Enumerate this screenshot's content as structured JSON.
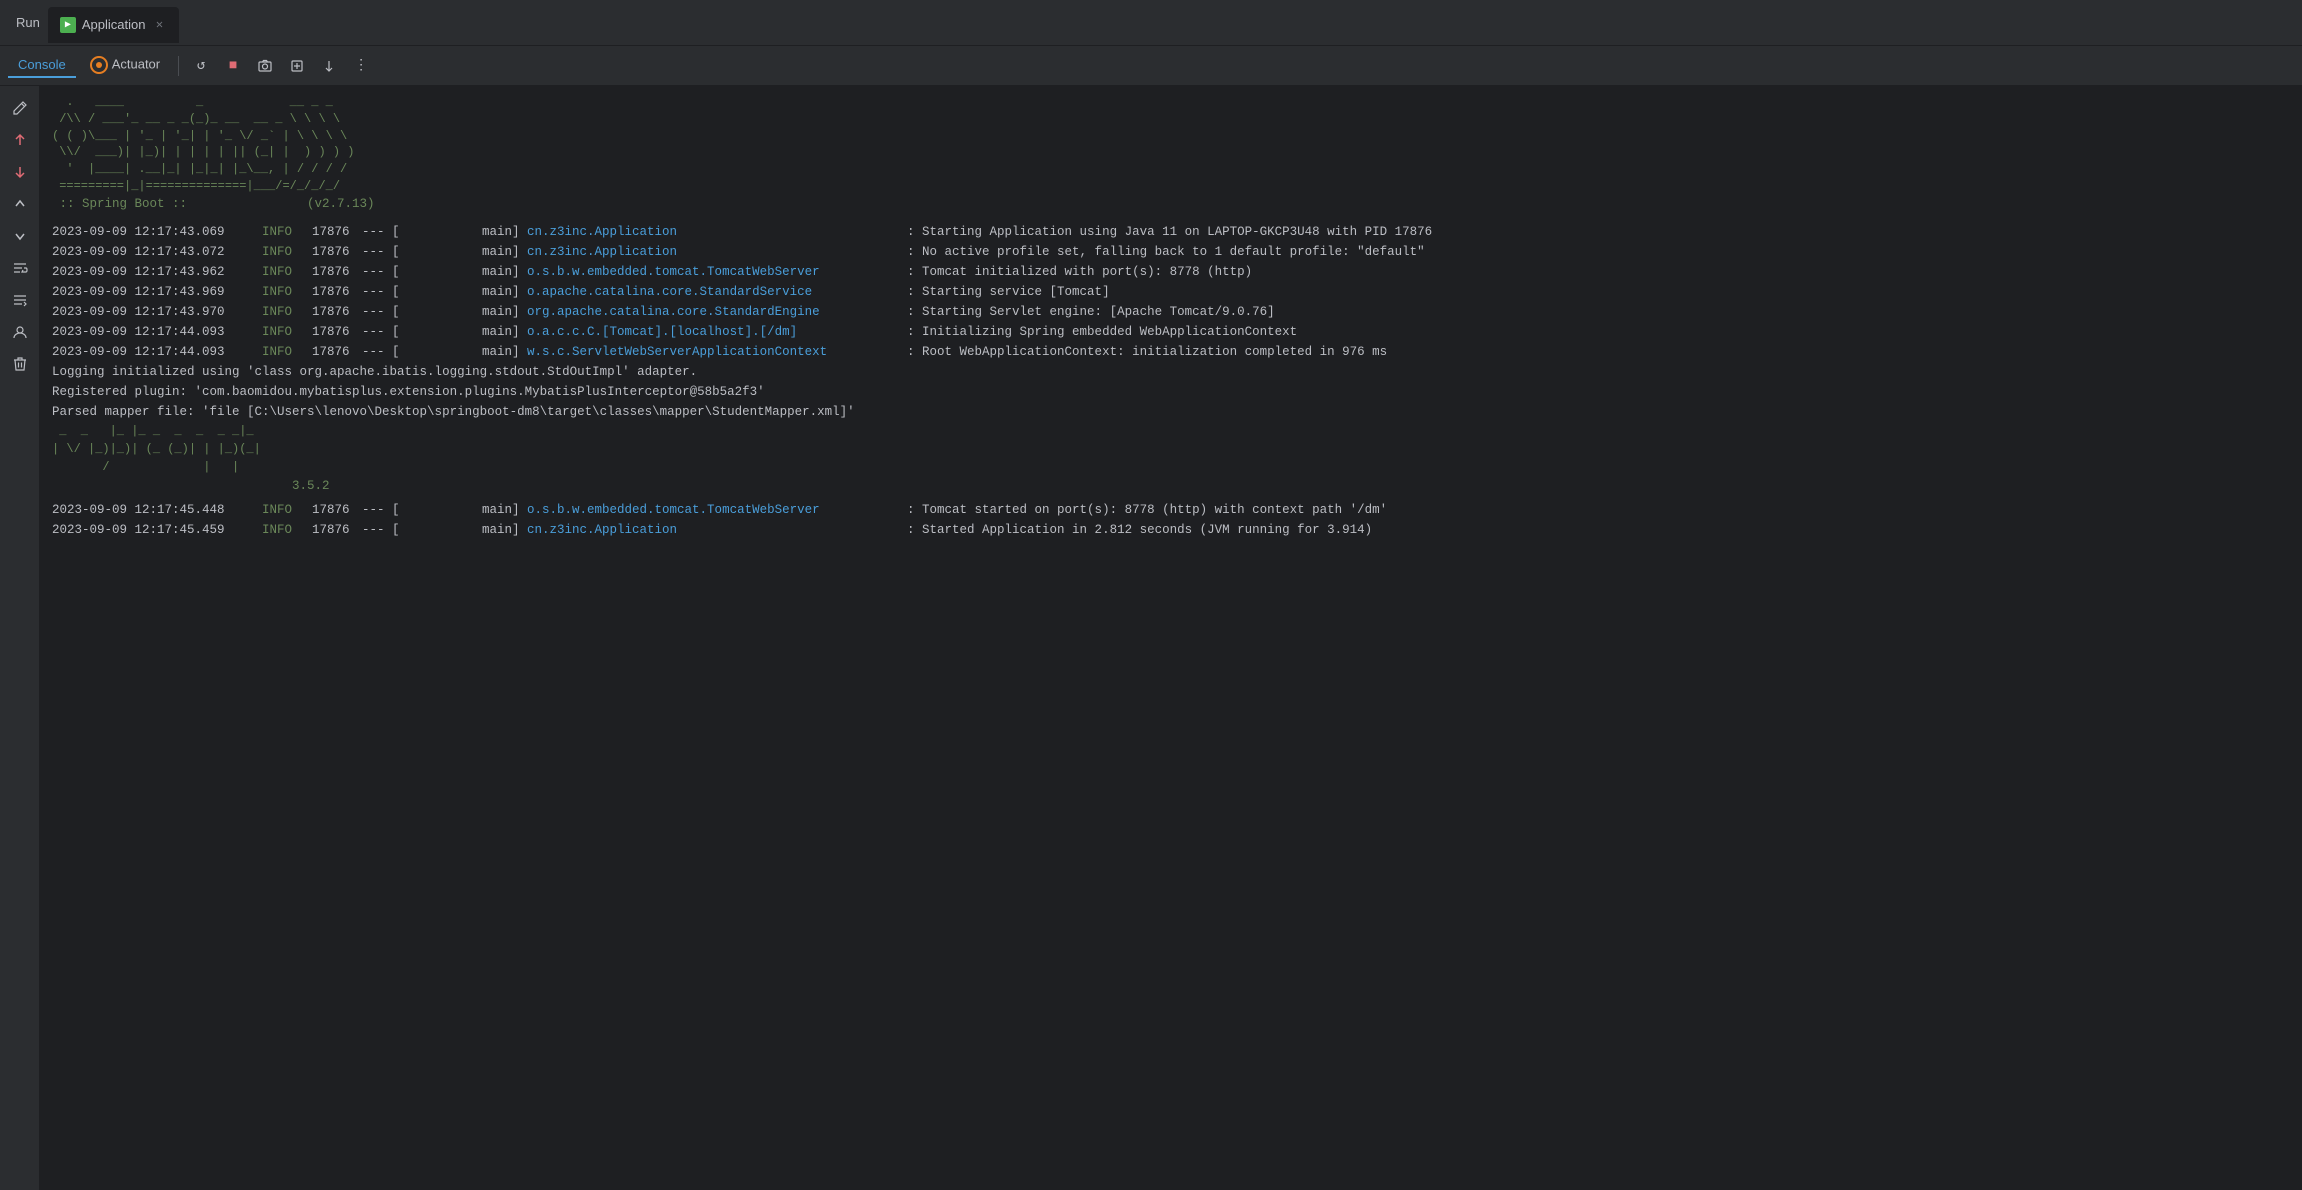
{
  "titleBar": {
    "runLabel": "Run",
    "tab": {
      "title": "Application",
      "icon": "▶"
    }
  },
  "toolbar": {
    "consoleTab": "Console",
    "actuatorTab": "Actuator"
  },
  "console": {
    "asciiArt1": "  .   ____          _            __ _ _\n /\\\\ / ___'_ __ _ _(_)_ __  __ _ \\ \\ \\ \\\n( ( )\\___ | '_ | '_| | '_ \\/ _` | \\ \\ \\ \\\n \\\\/  ___)| |_)| | | | | || (_| |  ) ) ) )\n  '  |____| .__|_| |_|_| |_\\__, | / / / /\n =========|_|==============|___/=/_/_/_/",
    "springBanner": " :: Spring Boot ::                (v2.7.13)",
    "logs": [
      {
        "timestamp": "2023-09-09 12:17:43.069",
        "level": "INFO",
        "pid": "17876",
        "thread": "--- [           main]",
        "class": "cn.z3inc.Application",
        "classType": "link",
        "message": " : Starting Application using Java 11 on LAPTOP-GKCP3U48 with PID 17876"
      },
      {
        "timestamp": "2023-09-09 12:17:43.072",
        "level": "INFO",
        "pid": "17876",
        "thread": "--- [           main]",
        "class": "cn.z3inc.Application",
        "classType": "link",
        "message": " : No active profile set, falling back to 1 default profile: \"default\""
      },
      {
        "timestamp": "2023-09-09 12:17:43.962",
        "level": "INFO",
        "pid": "17876",
        "thread": "--- [           main]",
        "class": "o.s.b.w.embedded.tomcat.TomcatWebServer",
        "classType": "link",
        "message": " : Tomcat initialized with port(s): 8778 (http)"
      },
      {
        "timestamp": "2023-09-09 12:17:43.969",
        "level": "INFO",
        "pid": "17876",
        "thread": "--- [           main]",
        "class": "o.apache.catalina.core.StandardService",
        "classType": "link",
        "message": " : Starting service [Tomcat]"
      },
      {
        "timestamp": "2023-09-09 12:17:43.970",
        "level": "INFO",
        "pid": "17876",
        "thread": "--- [           main]",
        "class": "org.apache.catalina.core.StandardEngine",
        "classType": "link",
        "message": " : Starting Servlet engine: [Apache Tomcat/9.0.76]"
      },
      {
        "timestamp": "2023-09-09 12:17:44.093",
        "level": "INFO",
        "pid": "17876",
        "thread": "--- [           main]",
        "class": "o.a.c.c.C.[Tomcat].[localhost].[/dm]",
        "classType": "link",
        "message": " : Initializing Spring embedded WebApplicationContext"
      },
      {
        "timestamp": "2023-09-09 12:17:44.093",
        "level": "INFO",
        "pid": "17876",
        "thread": "--- [           main]",
        "class": "w.s.c.ServletWebServerApplicationContext",
        "classType": "link",
        "message": " : Root WebApplicationContext: initialization completed in 976 ms"
      }
    ],
    "plainLogs": [
      "Logging initialized using 'class org.apache.ibatis.logging.stdout.StdOutImpl' adapter.",
      "Registered plugin: 'com.baomidou.mybatisplus.extension.plugins.MybatisPlusInterceptor@58b5a2f3'",
      "Parsed mapper file: 'file [C:\\Users\\lenovo\\Desktop\\springboot-dm8\\target\\classes\\mapper\\StudentMapper.xml]'"
    ],
    "mybatisArt": " _  _   |_ |_ _  _  _  _ _|_  \n| \\/ |_)|_)| (_ (_)| | |_)(_| \n       /             |   |      \n\n           3.5.2",
    "logs2": [
      {
        "timestamp": "2023-09-09 12:17:45.448",
        "level": "INFO",
        "pid": "17876",
        "thread": "--- [           main]",
        "class": "o.s.b.w.embedded.tomcat.TomcatWebServer",
        "classType": "link",
        "message": " : Tomcat started on port(s): 8778 (http) with context path '/dm'"
      },
      {
        "timestamp": "2023-09-09 12:17:45.459",
        "level": "INFO",
        "pid": "17876",
        "thread": "--- [           main]",
        "class": "cn.z3inc.Application",
        "classType": "link",
        "message": " : Started Application in 2.812 seconds (JVM running for 3.914)"
      }
    ]
  },
  "icons": {
    "rerun": "↺",
    "stop": "■",
    "screenshot": "📷",
    "restore": "⊡",
    "scroll": "⟳",
    "more": "⋯",
    "pencil": "✏",
    "arrowUp": "↑",
    "arrowDown": "↓",
    "arrowUpAlt": "↑",
    "arrowDownAlt": "↓",
    "lines": "≡",
    "linesDown": "≡",
    "user": "👤",
    "trash": "🗑"
  }
}
